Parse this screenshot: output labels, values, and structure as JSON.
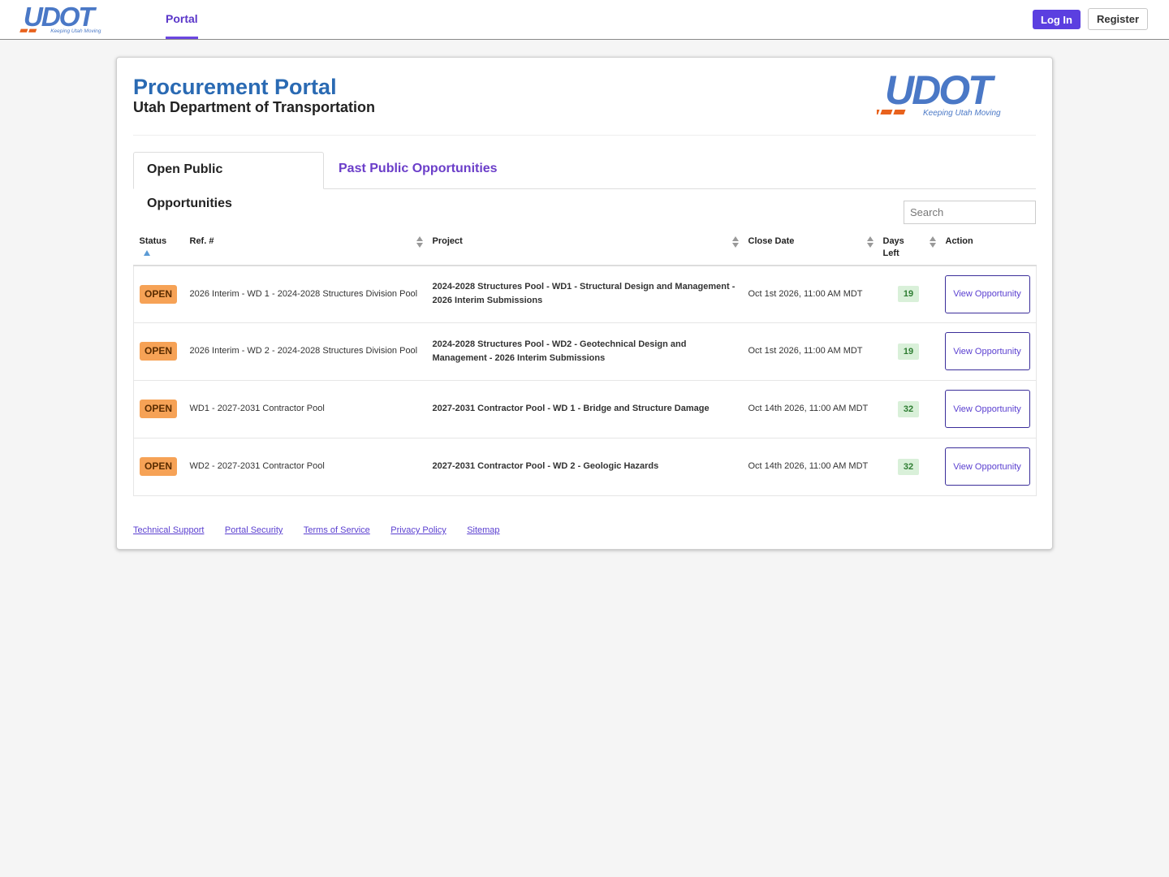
{
  "brand": {
    "logo_text": "UDOT",
    "tagline": "Keeping Utah Moving",
    "colors": {
      "blue": "#4a78c6",
      "orange": "#e8621d",
      "accent": "#5b3fe0"
    }
  },
  "topnav": {
    "portal_label": "Portal",
    "login_label": "Log In",
    "register_label": "Register"
  },
  "header": {
    "title": "Procurement Portal",
    "subtitle": "Utah Department of Transportation"
  },
  "tabs": [
    {
      "label": "Open Public Opportunities",
      "active": true
    },
    {
      "label": "Past Public Opportunities",
      "active": false
    }
  ],
  "search": {
    "placeholder": "Search"
  },
  "table": {
    "columns": {
      "status": "Status",
      "ref": "Ref. #",
      "project": "Project",
      "close_date": "Close Date",
      "days_left": "Days Left",
      "action": "Action"
    },
    "rows": [
      {
        "status": "OPEN",
        "ref": "2026 Interim - WD 1 - 2024-2028 Structures Division Pool",
        "project": "2024-2028 Structures Pool - WD1 - Structural Design and Management - 2026 Interim Submissions",
        "close_date": "Oct 1st 2026, 11:00 AM MDT",
        "days_left": "19",
        "action": "View Opportunity"
      },
      {
        "status": "OPEN",
        "ref": "2026 Interim - WD 2 - 2024-2028 Structures Division Pool",
        "project": "2024-2028 Structures Pool - WD2 - Geotechnical Design and Management - 2026 Interim Submissions",
        "close_date": "Oct 1st 2026, 11:00 AM MDT",
        "days_left": "19",
        "action": "View Opportunity"
      },
      {
        "status": "OPEN",
        "ref": "WD1 - 2027-2031 Contractor Pool",
        "project": "2027-2031 Contractor Pool - WD 1 - Bridge and Structure Damage",
        "close_date": "Oct 14th 2026, 11:00 AM MDT",
        "days_left": "32",
        "action": "View Opportunity"
      },
      {
        "status": "OPEN",
        "ref": "WD2 - 2027-2031 Contractor Pool",
        "project": "2027-2031 Contractor Pool - WD 2 - Geologic Hazards",
        "close_date": "Oct 14th 2026, 11:00 AM MDT",
        "days_left": "32",
        "action": "View Opportunity"
      }
    ]
  },
  "footer": {
    "links": [
      "Technical Support",
      "Portal Security",
      "Terms of Service",
      "Privacy Policy",
      "Sitemap"
    ]
  }
}
